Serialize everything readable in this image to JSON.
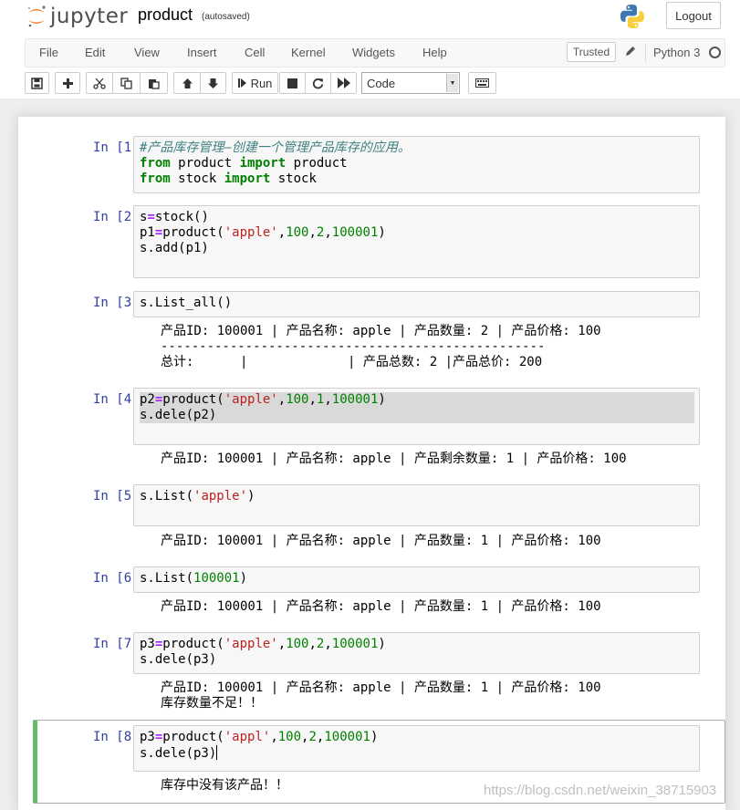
{
  "header": {
    "logo_text": "jupyter",
    "notebook_name": "product",
    "autosave_status": "(autosaved)",
    "logout_label": "Logout"
  },
  "menubar": {
    "items": [
      "File",
      "Edit",
      "View",
      "Insert",
      "Cell",
      "Kernel",
      "Widgets",
      "Help"
    ],
    "trusted_label": "Trusted",
    "kernel_name": "Python 3"
  },
  "toolbar": {
    "run_label": "Run",
    "cell_type": "Code",
    "buttons": [
      "save-icon",
      "plus-icon",
      "scissors-icon",
      "copy-icon",
      "paste-icon",
      "arrow-up-icon",
      "arrow-down-icon",
      "step-forward-icon",
      "stop-icon",
      "refresh-icon",
      "fast-forward-icon",
      "keyboard-icon"
    ]
  },
  "cells": [
    {
      "prompt": "In [1]:",
      "lines": [
        [
          {
            "t": "#产品库存管理—创建一个管理产品库存的应用。",
            "c": "comment"
          }
        ],
        [
          {
            "t": "from",
            "c": "kw"
          },
          {
            "t": " product ",
            "c": ""
          },
          {
            "t": "import",
            "c": "kw"
          },
          {
            "t": " product",
            "c": ""
          }
        ],
        [
          {
            "t": "from",
            "c": "kw"
          },
          {
            "t": " stock ",
            "c": ""
          },
          {
            "t": "import",
            "c": "kw"
          },
          {
            "t": " stock",
            "c": ""
          }
        ]
      ],
      "outputs": []
    },
    {
      "prompt": "In [2]:",
      "lines": [
        [
          {
            "t": "s",
            "c": ""
          },
          {
            "t": "=",
            "c": "op"
          },
          {
            "t": "stock()",
            "c": ""
          }
        ],
        [
          {
            "t": "p1",
            "c": ""
          },
          {
            "t": "=",
            "c": "op"
          },
          {
            "t": "product(",
            "c": ""
          },
          {
            "t": "'apple'",
            "c": "str"
          },
          {
            "t": ",",
            "c": ""
          },
          {
            "t": "100",
            "c": "num"
          },
          {
            "t": ",",
            "c": ""
          },
          {
            "t": "2",
            "c": "num"
          },
          {
            "t": ",",
            "c": ""
          },
          {
            "t": "100001",
            "c": "num"
          },
          {
            "t": ")",
            "c": ""
          }
        ],
        [
          {
            "t": "s.add(p1)",
            "c": ""
          }
        ],
        []
      ],
      "outputs": []
    },
    {
      "prompt": "In [3]:",
      "lines": [
        [
          {
            "t": "s.List_all()",
            "c": ""
          }
        ]
      ],
      "outputs": [
        "产品ID: 100001 | 产品名称: apple | 产品数量: 2 | 产品价格: 100",
        "--------------------------------------------------",
        "总计:      |             | 产品总数: 2 |产品总价: 200"
      ]
    },
    {
      "prompt": "In [4]:",
      "lines": [
        [
          {
            "t": "p2",
            "c": ""
          },
          {
            "t": "=",
            "c": "op"
          },
          {
            "t": "product(",
            "c": ""
          },
          {
            "t": "'apple'",
            "c": "str"
          },
          {
            "t": ",",
            "c": ""
          },
          {
            "t": "100",
            "c": "num"
          },
          {
            "t": ",",
            "c": ""
          },
          {
            "t": "1",
            "c": "num"
          },
          {
            "t": ",",
            "c": ""
          },
          {
            "t": "100001",
            "c": "num"
          },
          {
            "t": ")",
            "c": ""
          }
        ],
        [
          {
            "t": "s.dele(p2)",
            "c": ""
          }
        ],
        []
      ],
      "outputs": [
        "产品ID: 100001 | 产品名称: apple | 产品剩余数量: 1 | 产品价格: 100"
      ]
    },
    {
      "prompt": "In [5]:",
      "lines": [
        [
          {
            "t": "s.List(",
            "c": ""
          },
          {
            "t": "'apple'",
            "c": "str"
          },
          {
            "t": ")",
            "c": ""
          }
        ],
        []
      ],
      "outputs": [
        "产品ID: 100001 | 产品名称: apple | 产品数量: 1 | 产品价格: 100"
      ]
    },
    {
      "prompt": "In [6]:",
      "lines": [
        [
          {
            "t": "s.List(",
            "c": ""
          },
          {
            "t": "100001",
            "c": "num"
          },
          {
            "t": ")",
            "c": ""
          }
        ]
      ],
      "outputs": [
        "产品ID: 100001 | 产品名称: apple | 产品数量: 1 | 产品价格: 100"
      ]
    },
    {
      "prompt": "In [7]:",
      "lines": [
        [
          {
            "t": "p3",
            "c": ""
          },
          {
            "t": "=",
            "c": "op"
          },
          {
            "t": "product(",
            "c": ""
          },
          {
            "t": "'apple'",
            "c": "str"
          },
          {
            "t": ",",
            "c": ""
          },
          {
            "t": "100",
            "c": "num"
          },
          {
            "t": ",",
            "c": ""
          },
          {
            "t": "2",
            "c": "num"
          },
          {
            "t": ",",
            "c": ""
          },
          {
            "t": "100001",
            "c": "num"
          },
          {
            "t": ")",
            "c": ""
          }
        ],
        [
          {
            "t": "s.dele(p3)",
            "c": ""
          }
        ]
      ],
      "outputs": [
        "产品ID: 100001 | 产品名称: apple | 产品数量: 1 | 产品价格: 100",
        "库存数量不足！！"
      ]
    },
    {
      "prompt": "In [8]:",
      "lines": [
        [
          {
            "t": "p3",
            "c": ""
          },
          {
            "t": "=",
            "c": "op"
          },
          {
            "t": "product(",
            "c": ""
          },
          {
            "t": "'appl'",
            "c": "str"
          },
          {
            "t": ",",
            "c": ""
          },
          {
            "t": "100",
            "c": "num"
          },
          {
            "t": ",",
            "c": ""
          },
          {
            "t": "2",
            "c": "num"
          },
          {
            "t": ",",
            "c": ""
          },
          {
            "t": "100001",
            "c": "num"
          },
          {
            "t": ")",
            "c": ""
          }
        ],
        [
          {
            "t": "s.dele(p3)",
            "c": ""
          }
        ]
      ],
      "outputs": [
        "库存中没有该产品！！"
      ]
    }
  ],
  "watermark": "https://blog.csdn.net/weixin_38715903",
  "colors": {
    "accent_selected": "#66bb6a",
    "prompt": "#303f9f",
    "keyword": "#008000",
    "string": "#ba2121",
    "comment": "#408080",
    "operator": "#aa22ff"
  }
}
